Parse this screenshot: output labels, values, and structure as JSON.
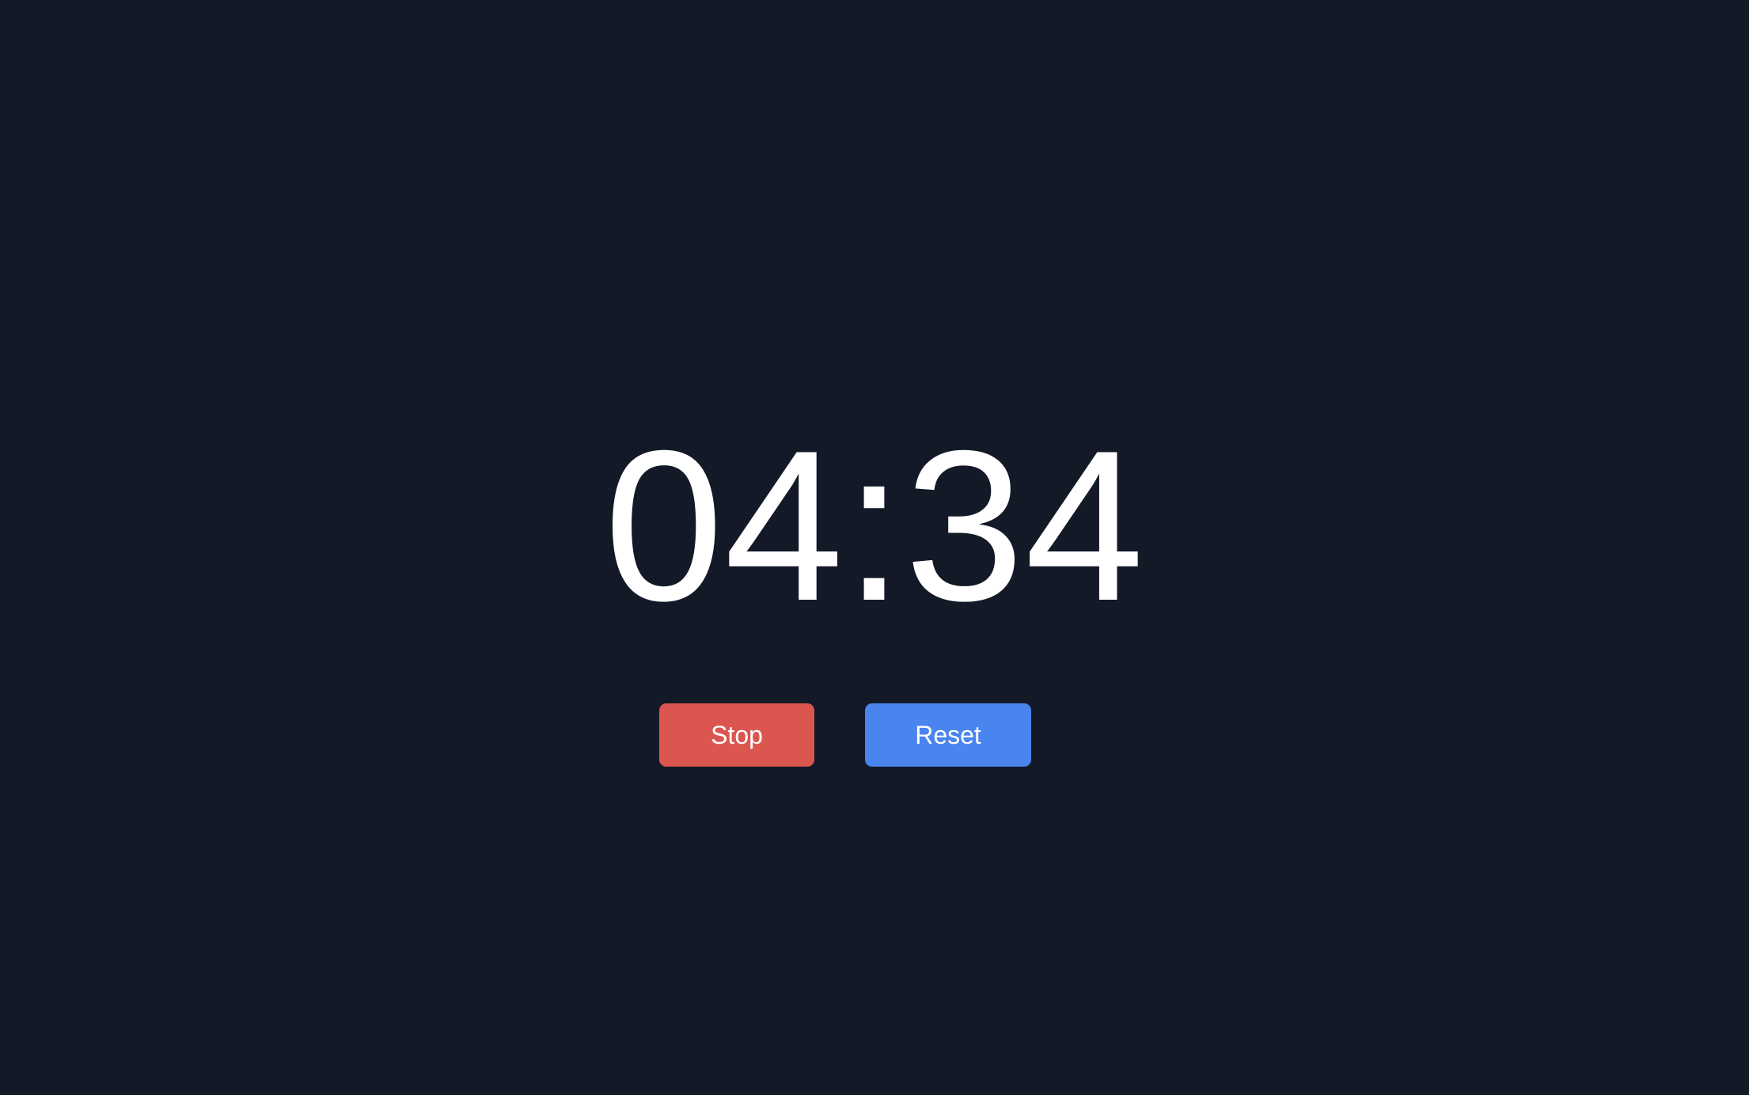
{
  "timer": {
    "display": "04:34"
  },
  "controls": {
    "stop_label": "Stop",
    "reset_label": "Reset"
  },
  "colors": {
    "background": "#131927",
    "text": "#ffffff",
    "stop_button": "#dc5650",
    "reset_button": "#4a84ef"
  }
}
